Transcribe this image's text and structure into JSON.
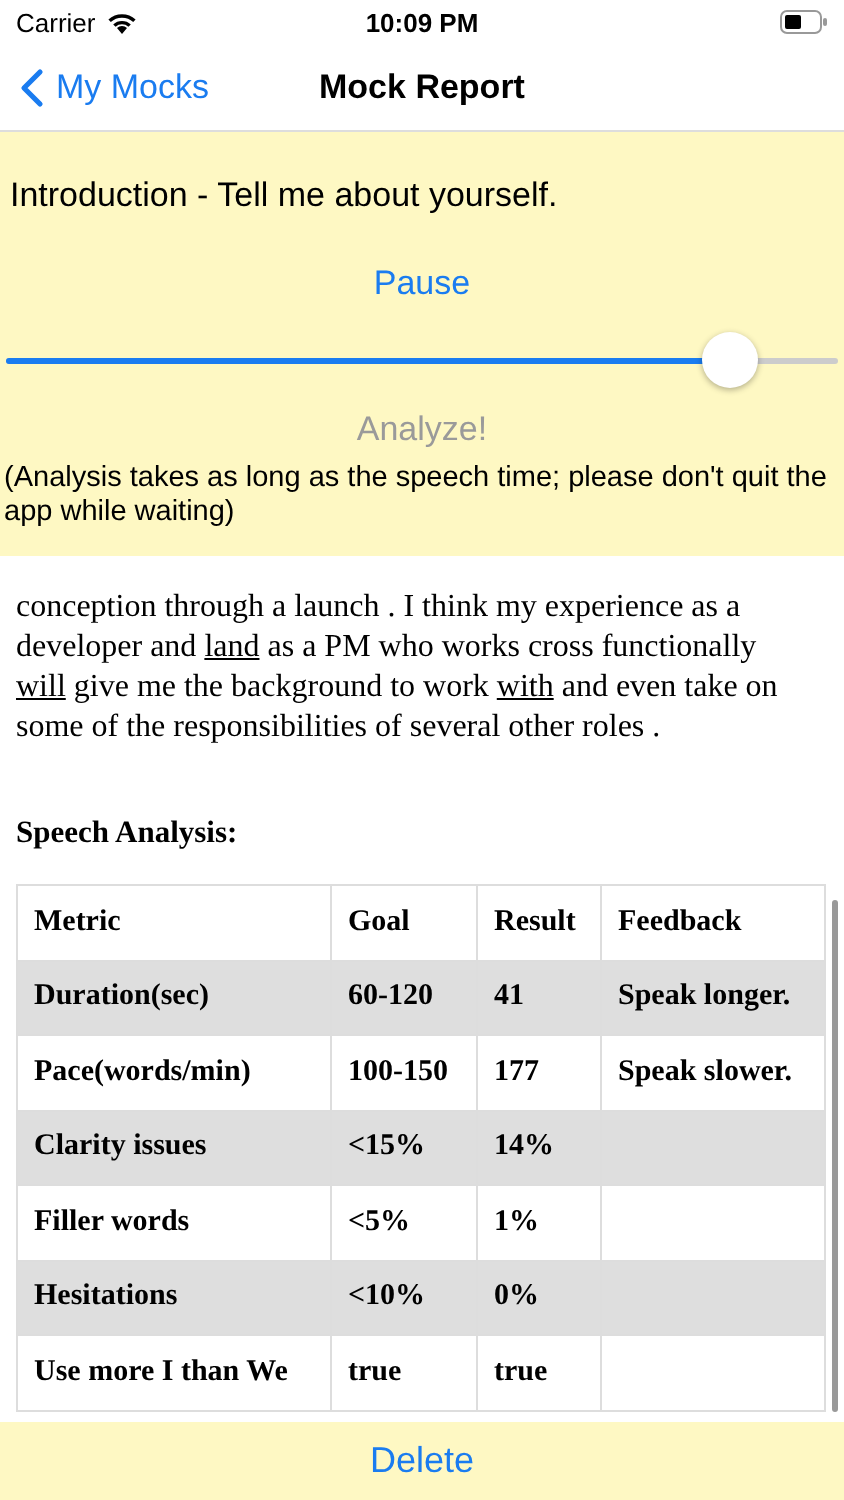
{
  "status_bar": {
    "carrier": "Carrier",
    "time": "10:09 PM"
  },
  "nav": {
    "back": "My Mocks",
    "title": "Mock Report"
  },
  "recorder": {
    "question": "Introduction - Tell me about yourself.",
    "pause": "Pause",
    "progress": {
      "level": 0.87
    },
    "analyze": {
      "label": "Analyze!",
      "disabled": true
    },
    "note": "(Analysis takes as long as the speech time; please don't quit the app while waiting)"
  },
  "transcript": [
    {
      "text": "conception through a launch . I think my experience as a developer and ",
      "underlined": false
    },
    {
      "text": "land",
      "underlined": true
    },
    {
      "text": " as a PM who works cross functionally ",
      "underlined": false
    },
    {
      "text": "will",
      "underlined": true
    },
    {
      "text": " give me the background to work ",
      "underlined": false
    },
    {
      "text": "with",
      "underlined": true
    },
    {
      "text": " and even take on some of the responsibilities of several other roles .",
      "underlined": false
    }
  ],
  "analysis": {
    "title": "Speech Analysis:",
    "columns": [
      "Metric",
      "Goal",
      "Result",
      "Feedback"
    ],
    "rows": [
      [
        "Duration(sec)",
        "60-120",
        "41",
        "Speak longer."
      ],
      [
        "Pace(words/min)",
        "100-150",
        "177",
        "Speak slower."
      ],
      [
        "Clarity issues",
        "<15%",
        "14%",
        ""
      ],
      [
        "Filler words",
        "<5%",
        "1%",
        ""
      ],
      [
        "Hesitations",
        "<10%",
        "0%",
        ""
      ],
      [
        "Use more I than We",
        "true",
        "true",
        ""
      ]
    ]
  },
  "delete": "Delete"
}
